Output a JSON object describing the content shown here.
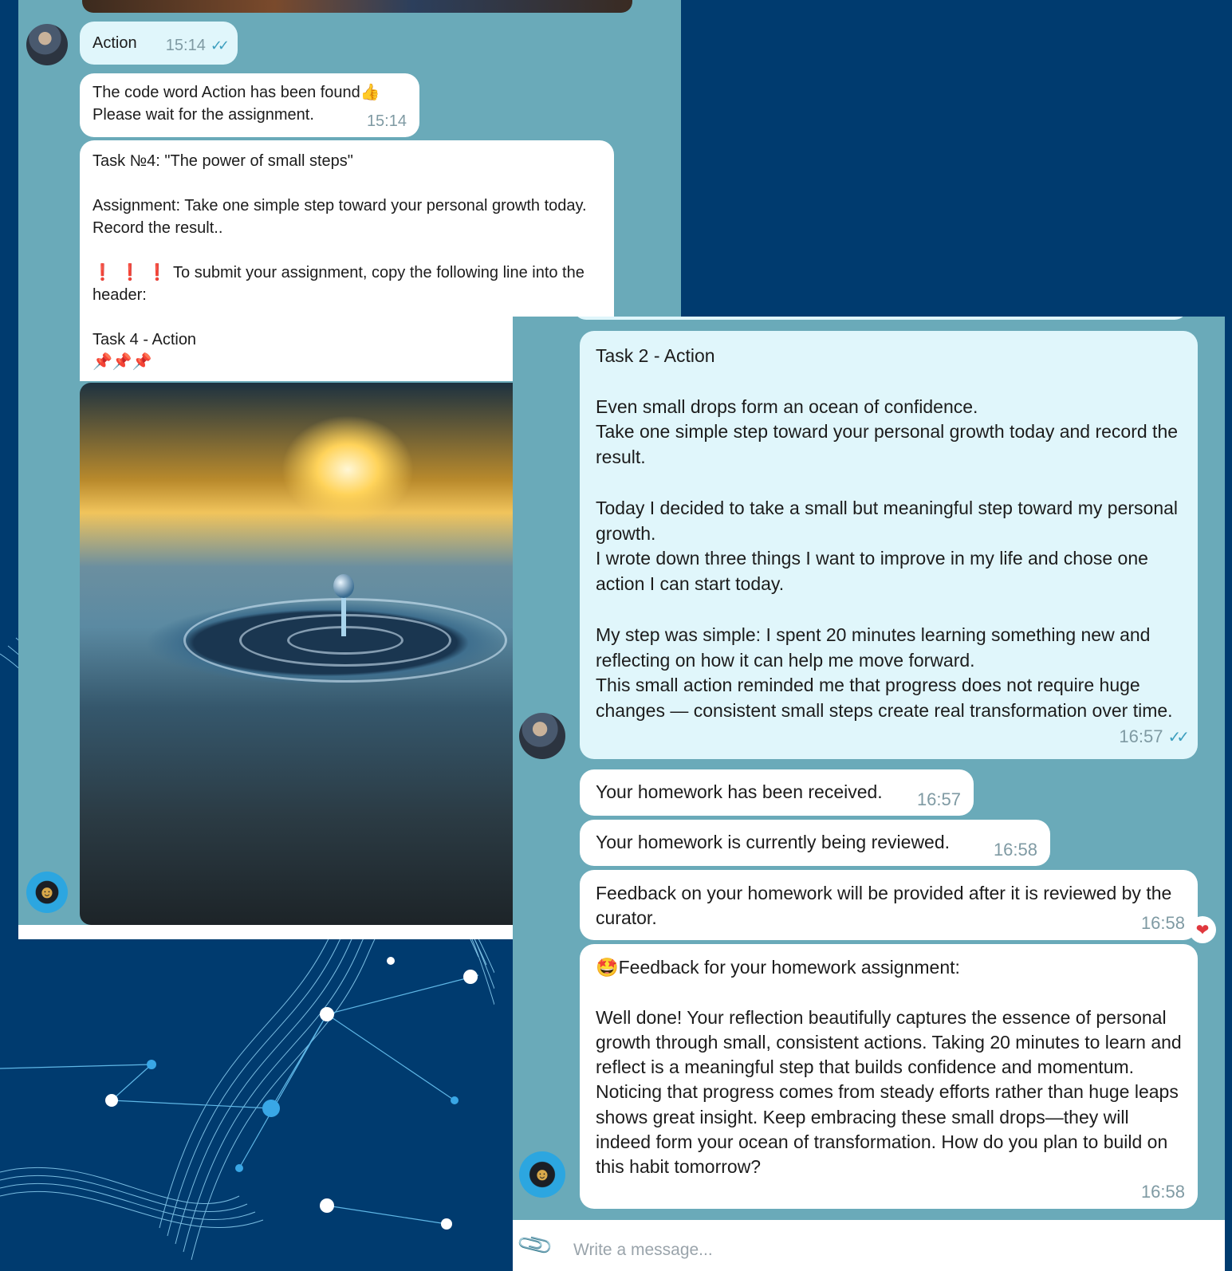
{
  "left_chat": {
    "msg_user_action": {
      "text": "Action",
      "time": "15:14",
      "ticks": "✓✓"
    },
    "msg_code_found": {
      "text": "The code word  Action has been found👍\nPlease wait for the assignment.",
      "time": "15:14"
    },
    "msg_task4": {
      "title": "Task №4: \"The power of small steps\"",
      "assignment": "Assignment: Take one simple step toward your personal growth today. Record the result..",
      "warning_icons": "❗ ❗ ❗",
      "warning_text": "To submit your assignment, copy the following line into the header:",
      "code_line": "Task 4 - Action",
      "pins": "📌📌📌"
    },
    "photo_alt": "water drop"
  },
  "right_chat": {
    "msg_task2": {
      "text": "Task 2 - Action\n\nEven small drops form an ocean of confidence.\nTake one simple step toward your personal growth today and record the result.\n\nToday I decided to take a small but meaningful step toward my personal growth.\nI wrote down three things I want to improve in my life and chose one action I can start today.\n\nMy step was simple: I spent 20 minutes learning something new and reflecting on how it can help me move forward.\nThis small action reminded me that progress does not require huge changes — consistent small steps create real transformation over time.",
      "time": "16:57",
      "ticks": "✓✓"
    },
    "msg_received": {
      "text": "Your homework has been received.",
      "time": "16:57"
    },
    "msg_reviewing": {
      "text": "Your homework is currently being reviewed.",
      "time": "16:58"
    },
    "msg_feedback_info": {
      "text": "Feedback on your homework will be provided after it is reviewed by the curator.",
      "time": "16:58",
      "reaction": "❤"
    },
    "msg_feedback": {
      "text": "🤩Feedback for your homework assignment:\n\nWell done! Your reflection beautifully captures the essence of personal growth through small, consistent actions. Taking 20 minutes to learn and reflect is a meaningful step that builds confidence and momentum. Noticing that progress comes from steady efforts rather than huge leaps shows great insight. Keep embracing these small drops—they will indeed form your ocean of transformation. How do you plan to build on this habit tomorrow?",
      "time": "16:58"
    },
    "composer": {
      "placeholder": "Write a message...",
      "attach_icon": "paperclip-icon"
    }
  },
  "colors": {
    "page_bg": "#003b6f",
    "chat_bg": "#6aaab9",
    "outgoing_bubble": "#e0f6fb",
    "incoming_bubble": "#ffffff",
    "tick": "#3d9fbf"
  }
}
